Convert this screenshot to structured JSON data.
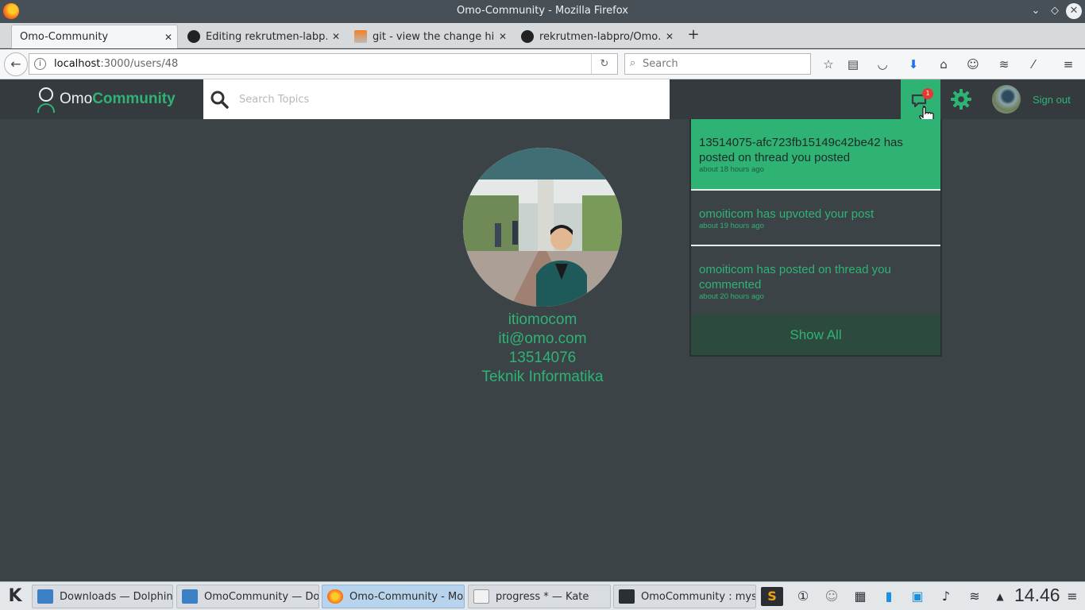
{
  "window": {
    "title": "Omo-Community - Mozilla Firefox",
    "minimize": "⌄",
    "maximize": "◇",
    "close": "✕"
  },
  "tabs": [
    {
      "label": "Omo-Community",
      "active": true
    },
    {
      "label": "Editing rekrutmen-labp…",
      "active": false
    },
    {
      "label": "git - view the change hi…",
      "active": false
    },
    {
      "label": "rekrutmen-labpro/Omo…",
      "active": false
    }
  ],
  "new_tab_label": "+",
  "nav": {
    "url_host": "localhost",
    "url_path": ":3000/users/48",
    "search_placeholder": "Search"
  },
  "app": {
    "logo_omo": "Omo",
    "logo_community": "Community",
    "search_placeholder": "Search Topics",
    "notification_count": "1",
    "signout_label": "Sign out",
    "accent_color": "#2fb375"
  },
  "profile": {
    "username": "itiomocom",
    "email": "iti@omo.com",
    "nim": "13514076",
    "major": "Teknik Informatika"
  },
  "notifications": {
    "items": [
      {
        "message": "13514075-afc723fb15149c42be42 has posted on thread you posted",
        "time": "about 18 hours ago",
        "unread": true
      },
      {
        "message": "omoiticom has upvoted your post",
        "time": "about 19 hours ago",
        "unread": false
      },
      {
        "message": "omoiticom has posted on thread you commented",
        "time": "about 20 hours ago",
        "unread": false
      }
    ],
    "show_all_label": "Show All"
  },
  "taskbar": {
    "tasks": [
      {
        "label": "Downloads — Dolphin"
      },
      {
        "label": "OmoCommunity — Dol"
      },
      {
        "label": "Omo-Community - Moz"
      },
      {
        "label": "progress * — Kate"
      },
      {
        "label": "OmoCommunity : myso"
      }
    ],
    "clock": "14.46"
  }
}
